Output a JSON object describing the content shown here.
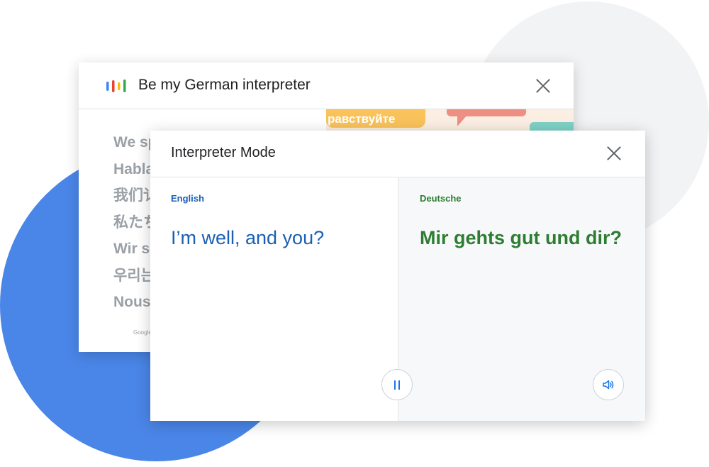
{
  "back_card": {
    "title": "Be my German interpreter",
    "banner_text": "равствуйте",
    "greetings": [
      "We sp",
      "Habla",
      "我们讠",
      "私たち",
      "Wir s",
      "우리는",
      "Nous"
    ],
    "footer_text": "Google"
  },
  "front_card": {
    "title": "Interpreter Mode",
    "source": {
      "language": "English",
      "phrase": "I’m well, and you?"
    },
    "target": {
      "language": "Deutsche",
      "phrase": "Mir gehts gut und dir?"
    }
  },
  "icons": {
    "assistant": "google-assistant-bars-icon",
    "close": "close-icon",
    "pause": "pause-icon",
    "speaker": "speaker-icon"
  },
  "colors": {
    "accent_blue": "#1a5fb4",
    "accent_green": "#2e7d32",
    "circle_blue": "#4a86e8",
    "circle_gray": "#f2f3f5"
  }
}
